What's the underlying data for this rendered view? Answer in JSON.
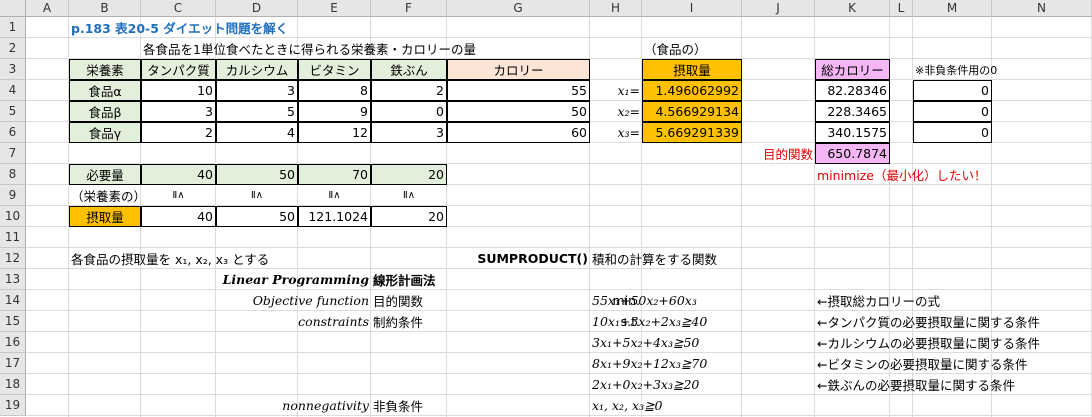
{
  "columns": [
    "A",
    "B",
    "C",
    "D",
    "E",
    "F",
    "G",
    "H",
    "I",
    "J",
    "K",
    "L",
    "M",
    "N"
  ],
  "rows": [
    "1",
    "2",
    "3",
    "4",
    "5",
    "6",
    "7",
    "8",
    "9",
    "10",
    "11",
    "12",
    "13",
    "14",
    "15",
    "16",
    "17",
    "18",
    "19"
  ],
  "title": "p.183 表20-5 ダイエット問題を解く",
  "nutrition_heading": "各食品を1単位食べたときに得られる栄養素・カロリーの量",
  "food_heading": "（食品の）",
  "table": {
    "header": [
      "栄養素",
      "タンパク質",
      "カルシウム",
      "ビタミン",
      "鉄ぶん",
      "カロリー"
    ],
    "rows": [
      {
        "name": "食品α",
        "values": [
          "10",
          "3",
          "8",
          "2",
          "55"
        ]
      },
      {
        "name": "食品β",
        "values": [
          "3",
          "5",
          "9",
          "0",
          "50"
        ]
      },
      {
        "name": "食品γ",
        "values": [
          "2",
          "4",
          "12",
          "3",
          "60"
        ]
      }
    ]
  },
  "intake": {
    "header": "摂取量",
    "labels": [
      "x₁=",
      "x₂=",
      "x₃="
    ],
    "values": [
      "1.496062992",
      "4.566929134",
      "5.669291339"
    ]
  },
  "calories": {
    "header": "総カロリー",
    "values": [
      "82.28346",
      "228.3465",
      "340.1575"
    ],
    "objective_label": "目的関数",
    "objective_value": "650.7874",
    "minimize_note": "minimize（最小化）したい！"
  },
  "nonneg": {
    "header": "※非負条件用の0",
    "values": [
      "0",
      "0",
      "0"
    ]
  },
  "required": {
    "label": "必要量",
    "values": [
      "40",
      "50",
      "70",
      "20"
    ],
    "sub_label": "（栄養素の）",
    "ge": [
      "Ⅱ∧",
      "Ⅱ∧",
      "Ⅱ∧",
      "Ⅱ∧"
    ],
    "intake_label": "摂取量",
    "intake_values": [
      "40",
      "50",
      "121.1024",
      "20"
    ]
  },
  "notes": {
    "intake_sentence": "各食品の摂取量を x₁, x₂, x₃ とする",
    "sumproduct_name": "SUMPRODUCT()",
    "sumproduct_desc": "積和の計算をする関数",
    "lp_en": "Linear Programming",
    "lp_jp": "線形計画法",
    "obj_en": "Objective function",
    "obj_jp": "目的関数",
    "cons_en": "constraints",
    "cons_jp": "制約条件",
    "nonneg_en": "nonnegativity",
    "nonneg_jp": "非負条件",
    "min_label": "min.",
    "st_label": "s.t.",
    "objective": "55x₁+50x₂+60x₃",
    "c1": "10x₁+3x₂+2x₃≧40",
    "c2": "3x₁+5x₂+4x₃≧50",
    "c3": "8x₁+9x₂+12x₃≧70",
    "c4": "2x₁+0x₂+3x₃≧20",
    "nn": "x₁, x₂, x₃≧0",
    "arrow_obj": "←摂取総カロリーの式",
    "arrow_c1": "←タンパク質の必要摂取量に関する条件",
    "arrow_c2": "←カルシウムの必要摂取量に関する条件",
    "arrow_c3": "←ビタミンの必要摂取量に関する条件",
    "arrow_c4": "←鉄ぶんの必要摂取量に関する条件"
  },
  "colors": {
    "green": "#e2efda",
    "peach": "#fce4d6",
    "orange": "#ffc000",
    "pink": "#f4b6f4",
    "title_blue": "#1f6fbf",
    "red": "#e00000"
  }
}
